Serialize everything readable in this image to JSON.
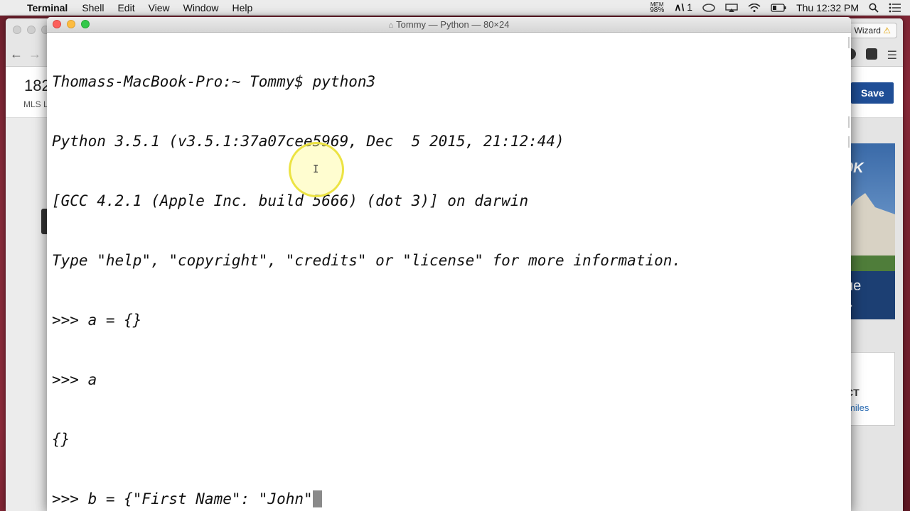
{
  "menubar": {
    "app_name": "Terminal",
    "items": [
      "Shell",
      "Edit",
      "View",
      "Window",
      "Help"
    ],
    "mem_label": "MEM",
    "mem_value": "98%",
    "notif_count": "1",
    "clock": "Thu 12:32 PM"
  },
  "browser": {
    "wizard_label": "Wizard",
    "price_partial": "182",
    "mls_partial": "MLS L",
    "save_label": "Save",
    "ad_price": "0K",
    "ad_text": "ue",
    "ad_arrow": "»",
    "miles_ct": "CT",
    "miles_text": "miles"
  },
  "terminal": {
    "title": "Tommy — Python — 80×24",
    "lines": [
      "Thomass-MacBook-Pro:~ Tommy$ python3",
      "Python 3.5.1 (v3.5.1:37a07cee5969, Dec  5 2015, 21:12:44)",
      "[GCC 4.2.1 (Apple Inc. build 5666) (dot 3)] on darwin",
      "Type \"help\", \"copyright\", \"credits\" or \"license\" for more information.",
      ">>> a = {}",
      ">>> a",
      "{}",
      ">>> b = {\"First Name\": \"John\""
    ]
  },
  "colors": {
    "terminal_bg": "#ffffff",
    "close": "#fc605c",
    "minimize": "#fdbc40",
    "zoom": "#34c84a",
    "save_button": "#1f4e96"
  },
  "icons": {
    "apple": "apple-icon",
    "search": "search-icon",
    "wifi": "wifi-icon",
    "battery": "battery-icon",
    "list": "notification-list-icon"
  }
}
